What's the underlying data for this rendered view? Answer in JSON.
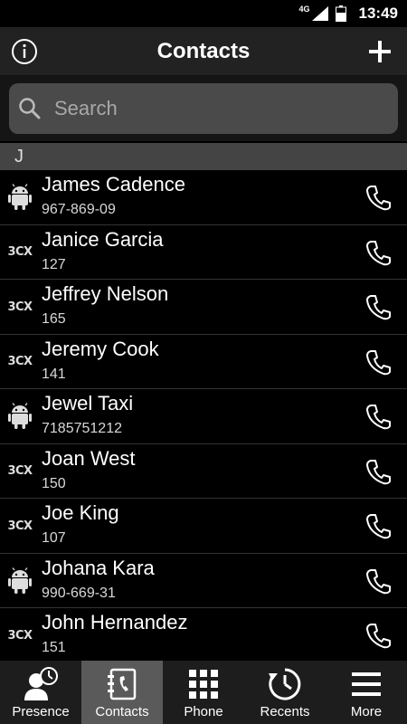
{
  "status": {
    "network": "4G",
    "time": "13:49"
  },
  "header": {
    "title": "Contacts",
    "info_icon": "info-icon",
    "add_icon": "plus-icon"
  },
  "search": {
    "placeholder": "Search"
  },
  "section": {
    "letter": "J"
  },
  "contacts": [
    {
      "name": "James Cadence",
      "number": "967-869-09",
      "source": "android"
    },
    {
      "name": "Janice Garcia",
      "number": "127",
      "source": "3cx"
    },
    {
      "name": "Jeffrey Nelson",
      "number": "165",
      "source": "3cx"
    },
    {
      "name": "Jeremy Cook",
      "number": "141",
      "source": "3cx"
    },
    {
      "name": "Jewel Taxi",
      "number": "7185751212",
      "source": "android"
    },
    {
      "name": "Joan West",
      "number": "150",
      "source": "3cx"
    },
    {
      "name": "Joe King",
      "number": "107",
      "source": "3cx"
    },
    {
      "name": "Johana Kara",
      "number": "990-669-31",
      "source": "android"
    },
    {
      "name": "John Hernandez",
      "number": "151",
      "source": "3cx"
    }
  ],
  "source_logo_text": "3CX",
  "nav": {
    "tabs": [
      {
        "label": "Presence",
        "icon": "presence-icon",
        "active": false
      },
      {
        "label": "Contacts",
        "icon": "contacts-icon",
        "active": true
      },
      {
        "label": "Phone",
        "icon": "dialpad-icon",
        "active": false
      },
      {
        "label": "Recents",
        "icon": "recents-icon",
        "active": false
      },
      {
        "label": "More",
        "icon": "menu-icon",
        "active": false
      }
    ]
  },
  "colors": {
    "background": "#000000",
    "appbar": "#222222",
    "search_field": "#4a4a4a",
    "section": "#444444",
    "active_tab": "#5a5a5a"
  }
}
